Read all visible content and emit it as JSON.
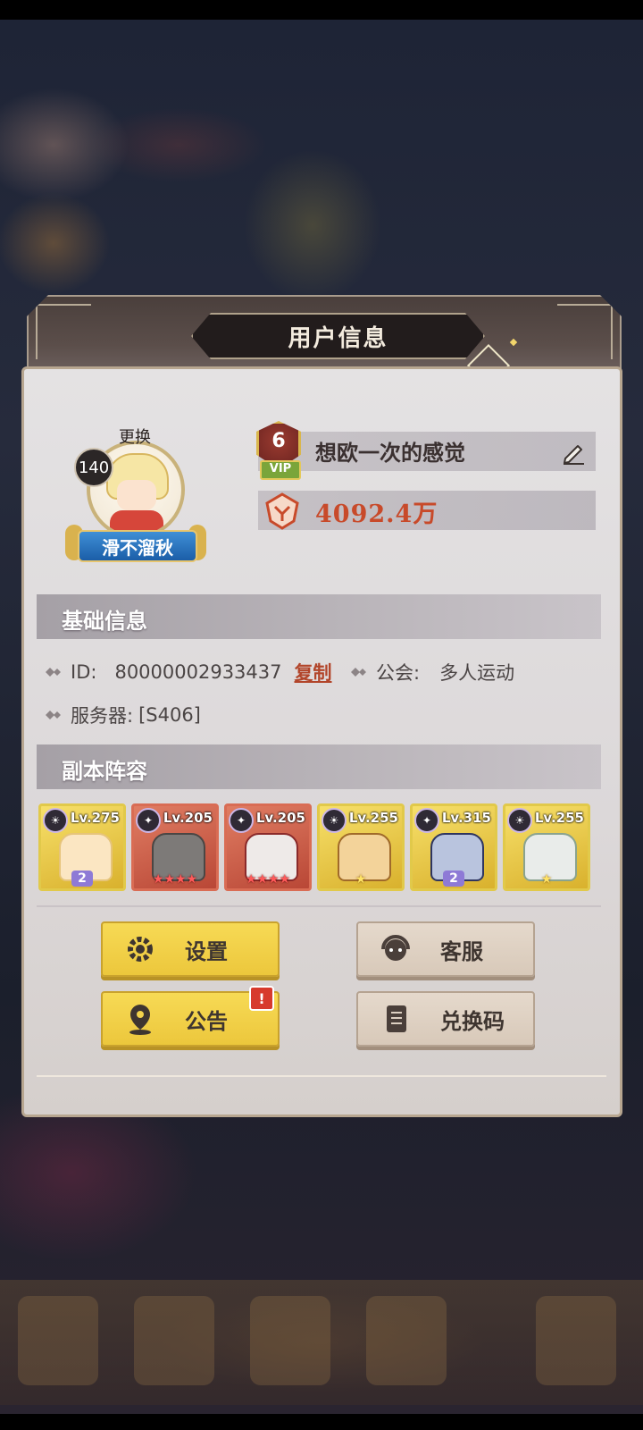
{
  "dialog": {
    "title": "用户信息",
    "avatar": {
      "change_label": "更换",
      "level": "140",
      "title_badge": "滑不溜秋"
    },
    "player": {
      "vip_level": "6",
      "vip_label": "VIP",
      "name": "想欧一次的感觉",
      "power": "4092.4万"
    },
    "basic_info": {
      "header": "基础信息",
      "id_label": "ID:",
      "id_value": "80000002933437",
      "copy_label": "复制",
      "guild_label": "公会:",
      "guild_value": "多人运动",
      "server_label": "服务器:",
      "server_value": "[S406]"
    },
    "lineup": {
      "header": "副本阵容",
      "heroes": [
        {
          "level": "Lv.275",
          "stars": "2"
        },
        {
          "level": "Lv.205",
          "stars": "★★★★"
        },
        {
          "level": "Lv.205",
          "stars": "★★★★"
        },
        {
          "level": "Lv.255",
          "stars": "★"
        },
        {
          "level": "Lv.315",
          "stars": "2"
        },
        {
          "level": "Lv.255",
          "stars": "★"
        }
      ]
    },
    "buttons": {
      "settings": "设置",
      "customer_service": "客服",
      "announcement": "公告",
      "announcement_alert": "!",
      "redeem_code": "兑换码"
    }
  },
  "colors": {
    "accent_yellow": "#f1d04a",
    "button_tan": "#ddd0c2",
    "power_text": "#c84a2a",
    "copy_link": "#b2452a"
  },
  "icons": [
    "edit-icon",
    "power-icon",
    "gear-icon",
    "headset-icon",
    "location-pin-icon",
    "notebook-icon"
  ]
}
